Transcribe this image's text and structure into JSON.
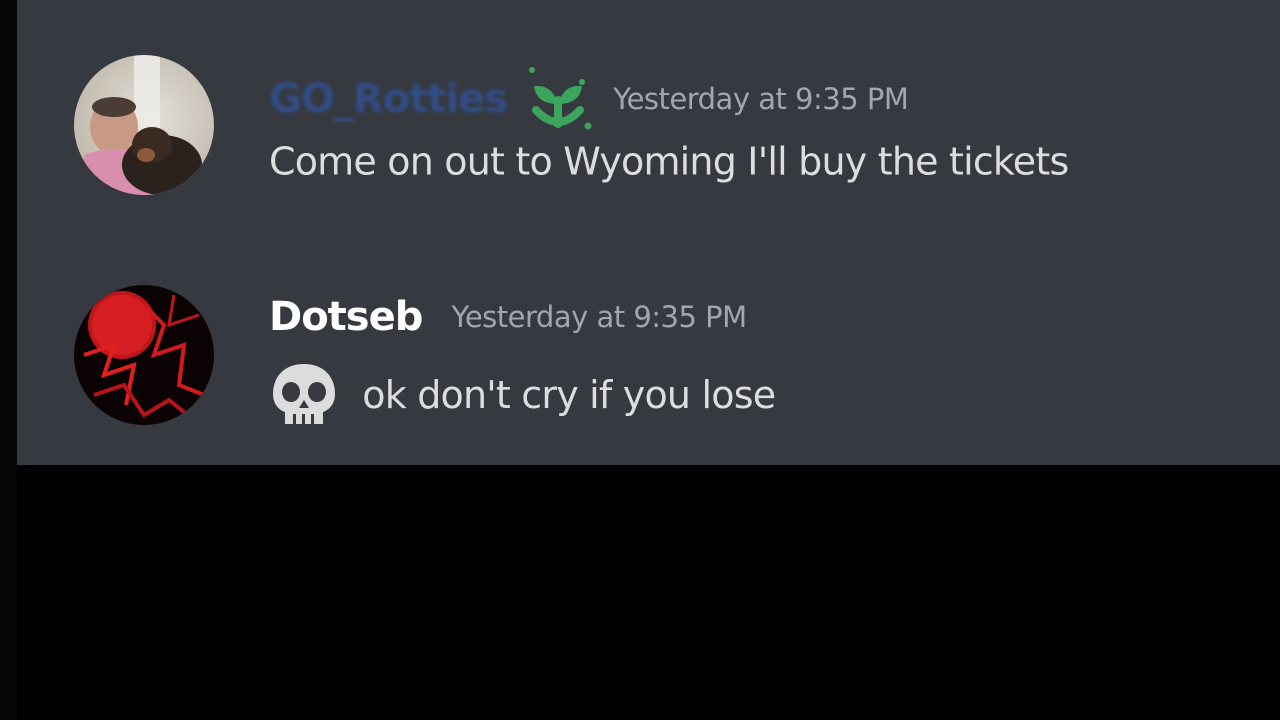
{
  "messages": [
    {
      "username": "GO_Rotties",
      "timestamp": "Yesterday at 9:35 PM",
      "content": "Come on out to Wyoming I'll buy the tickets",
      "badge_icon": "seedling-badge-icon",
      "username_color": "#2f5ec0"
    },
    {
      "username": "Dotseb",
      "timestamp": "Yesterday at 9:35 PM",
      "emoji": "skull-emoji",
      "content": "ok don't cry if you lose",
      "username_color": "#ffffff"
    }
  ],
  "colors": {
    "chat_background": "#36393f",
    "message_text": "#dcddde",
    "timestamp_text": "#a3a6aa",
    "badge_green": "#3ba55c"
  }
}
